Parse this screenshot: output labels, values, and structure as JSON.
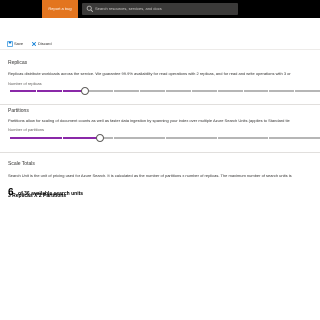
{
  "topbar": {
    "report_bug_label": "Report a bug",
    "search_placeholder": "Search resources, services, and docs"
  },
  "toolbar": {
    "save_label": "Save",
    "discard_label": "Discard"
  },
  "replicas": {
    "title": "Replicas",
    "description": "Replicas distribute workloads across the service. We guarantee 99.9% availability for read operations with 2 replicas, and for read and write operations with 3 or",
    "field_label": "Number of replicas",
    "value": 3,
    "max": 12
  },
  "partitions": {
    "title": "Partitions",
    "description": "Partitions allow for scaling of document counts as well as faster data ingestion by spanning your index over multiple Azure Search Units (applies to Standard tie",
    "field_label": "Number of partitions",
    "value": 2,
    "options": 6
  },
  "scale": {
    "title": "Scale Totals",
    "description": "Search Unit is the unit of pricing used for Azure Search. It is calculated as the number of partitions x number of replicas. The maximum number of search units is",
    "units_value": "6",
    "units_text": "of 36 available search units",
    "formula": "3 Replicas X 2 Partitions"
  },
  "colors": {
    "accent": "#8a29a8",
    "report_bug": "#e3751f",
    "topbar": "#000000"
  },
  "icons": [
    "search-icon",
    "save-icon",
    "discard-icon"
  ]
}
